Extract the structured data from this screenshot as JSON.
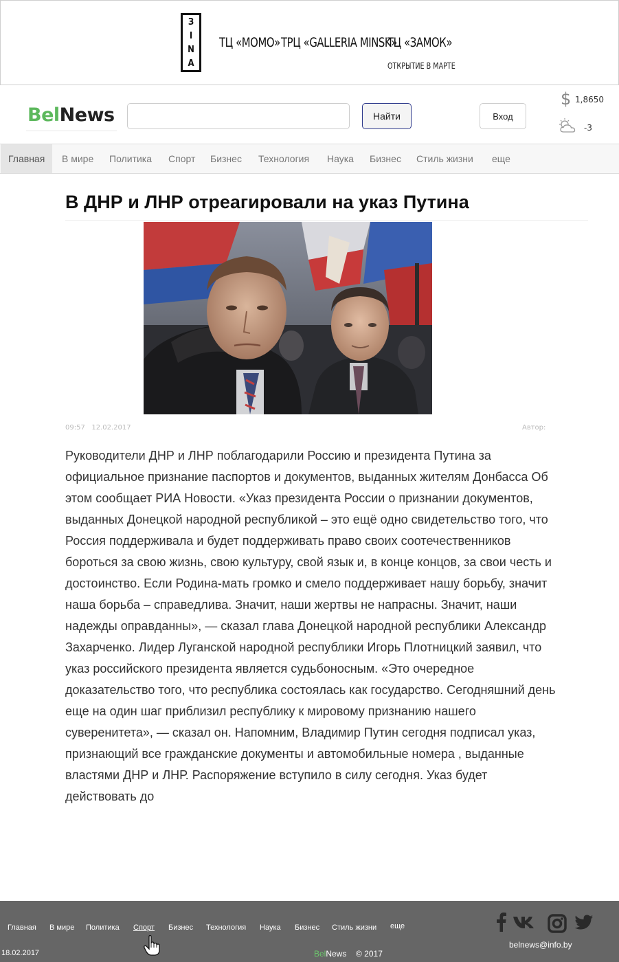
{
  "banner": {
    "logo_text": "ЗINA",
    "items": [
      "ТЦ «MOMO»",
      "ТРЦ «GALLERIA MINSK»",
      "ТЦ «ЗАМОК»"
    ],
    "subtitle": "ОТКРЫТИЕ В МАРТЕ"
  },
  "header": {
    "logo_green": "Bel",
    "logo_dark": "News",
    "search_placeholder": "",
    "search_button": "Найти",
    "login_button": "Вход",
    "currency_icon": "dollar-icon",
    "currency_rate": "1,8650",
    "weather_icon": "partly-cloudy-icon",
    "temperature": "-3"
  },
  "nav": {
    "items": [
      "Главная",
      "В мире",
      "Политика",
      "Спорт",
      "Бизнес",
      "Технология",
      "Наука",
      "Бизнес",
      "Стиль жизни",
      "еще"
    ],
    "active": "Главная"
  },
  "article": {
    "title": "В ДНР и ЛНР отреагировали на указ Путина",
    "time": "09:57",
    "date": "12.02.2017",
    "author_label": "Автор:",
    "body": "Руководители ДНР и ЛНР поблагодарили Россию и президента Путина за официальное признание паспортов и документов, выданных жителям Донбасса Об этом сообщает РИА Новости. «Указ президента России о признании документов, выданных Донецкой народной республикой – это ещё одно свидетельство того, что Россия поддерживала и будет поддерживать право своих соотечественников бороться за свою жизнь, свою культуру, свой язык и, в конце концов, за свои честь и достоинство. Если Родина-мать громко и смело поддерживает нашу борьбу, значит наша борьба – справедлива. Значит, наши жертвы не напрасны. Значит, наши надежды оправданны», — сказал глава Донецкой народной республики Александр Захарченко. Лидер Луганской народной республики Игорь Плотницкий заявил, что указ российского президента является судьбоносным. «Это очередное доказательство того, что республика состоялась как государство. Сегодняшний день еще на один шаг приблизил республику к мировому признанию нашего суверенитета», — сказал он. Напомним, Владимир Путин сегодня подписал указ, признающий все гражданские документы и автомобильные номера , выданные властями ДНР и ЛНР. Распоряжение вступило в силу сегодня. Указ будет действовать до"
  },
  "footer": {
    "nav": [
      "Главная",
      "В мире",
      "Политика",
      "Спорт",
      "Бизнес",
      "Технология",
      "Наука",
      "Бизнес",
      "Стиль жизни",
      "еще"
    ],
    "date": "18.02.2017",
    "logo_green": "Bel",
    "logo_dark": "News",
    "copyright": "© 2017",
    "email": "belnews@info.by",
    "social_icons": [
      "facebook-icon",
      "vk-icon",
      "instagram-icon",
      "twitter-icon"
    ]
  },
  "colors": {
    "brand_green": "#5cb85c",
    "footer_bg": "#666666",
    "nav_bg": "#f7f7f7"
  }
}
